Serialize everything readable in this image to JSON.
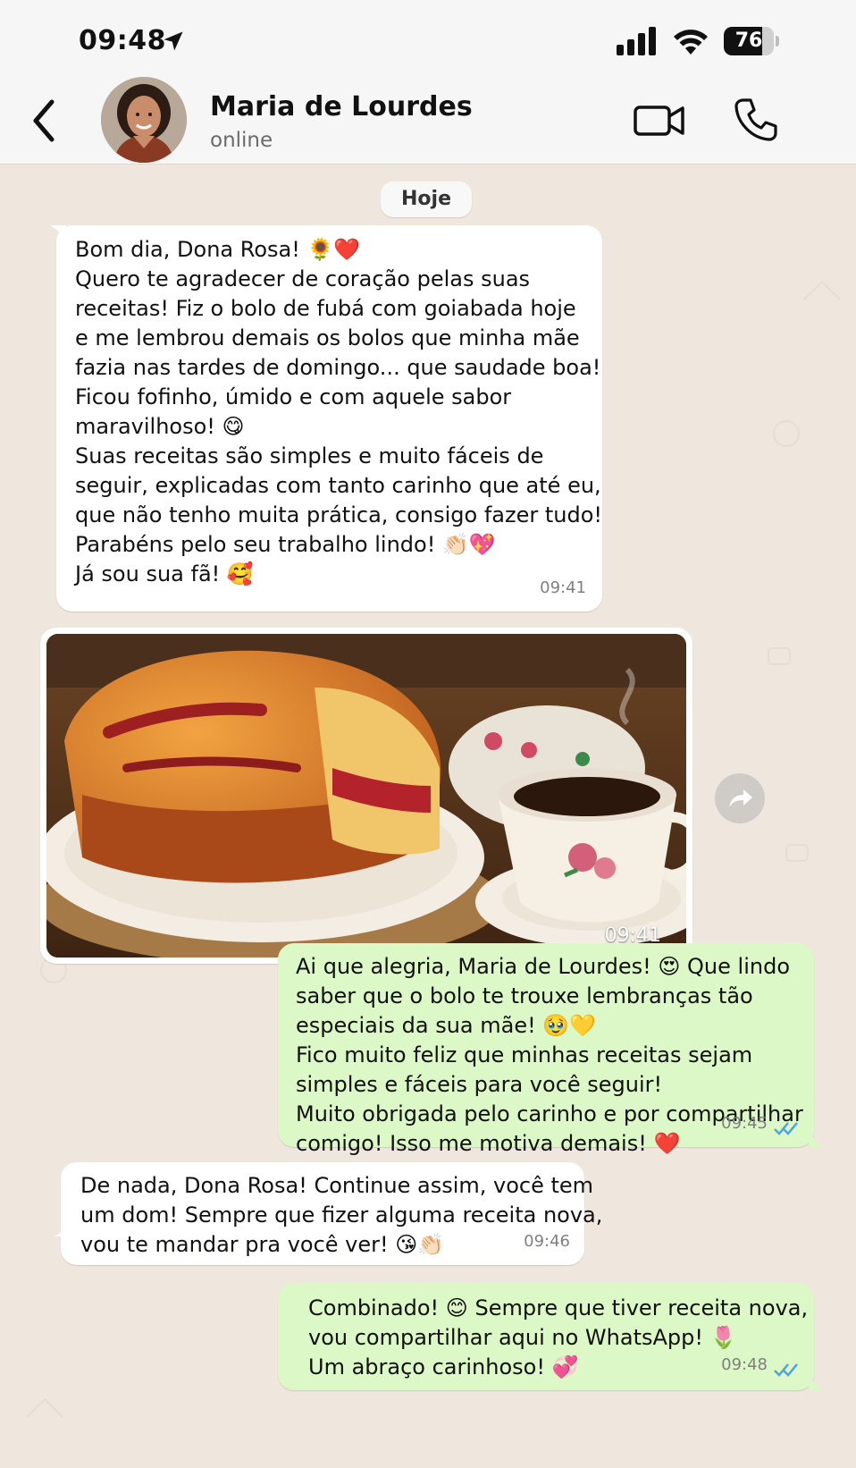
{
  "status_bar": {
    "time": "09:48",
    "battery_level": "76",
    "battery_fraction": 0.76,
    "icons": [
      "location-arrow-icon",
      "signal-icon",
      "wifi-icon",
      "battery-icon"
    ]
  },
  "header": {
    "contact_name": "Maria de Lourdes",
    "contact_status": "online",
    "icons": [
      "back-chevron-icon",
      "video-camera-icon",
      "phone-icon"
    ]
  },
  "chat": {
    "date_separator": "Hoje",
    "messages": [
      {
        "direction": "in",
        "lines": [
          "Bom dia, Dona Rosa! 🌻❤️",
          "Quero te agradecer de coração pelas suas",
          "receitas! Fiz o bolo de fubá com goiabada hoje",
          "e me lembrou demais os bolos que minha mãe",
          "fazia nas tardes de domingo... que saudade boa!",
          "Ficou fofinho, úmido e com aquele sabor",
          "maravilhoso! 😋",
          "Suas receitas são simples e muito fáceis de",
          "seguir, explicadas com tanto carinho que até eu,",
          "que não tenho muita prática, consigo fazer tudo!",
          "Parabéns pelo seu trabalho lindo! 👏🏻💖",
          "Já sou sua fã! 🥰"
        ],
        "time": "09:41"
      },
      {
        "direction": "in",
        "type": "image",
        "image_description_icon": "photo-cake-coffee",
        "time": "09:41"
      },
      {
        "direction": "out",
        "lines": [
          "Ai que alegria, Maria de Lourdes! 😍 Que lindo",
          "saber que o bolo te trouxe lembranças tão",
          "especiais da sua mãe! 🥹💛",
          "Fico muito feliz que minhas receitas sejam",
          "simples e fáceis para você seguir!",
          "Muito obrigada pelo carinho e por compartilhar",
          "comigo! Isso me motiva demais! ❤️"
        ],
        "time": "09:45",
        "read": true
      },
      {
        "direction": "in",
        "lines": [
          "De nada, Dona Rosa! Continue assim, você tem",
          "um dom! Sempre que fizer alguma receita nova,",
          "vou te mandar pra você ver! 😘👏🏻"
        ],
        "time": "09:46"
      },
      {
        "direction": "out",
        "lines": [
          "Combinado! 😊 Sempre que tiver receita nova,",
          "vou compartilhar aqui no WhatsApp! 🌷",
          "Um abraço carinhoso! 💞"
        ],
        "time": "09:48",
        "read": true
      }
    ]
  },
  "colors": {
    "chat_background": "#efe7dd",
    "incoming_bubble": "#ffffff",
    "outgoing_bubble": "#dcf8c6",
    "read_ticks": "#4fa3e3",
    "header_background": "#f6f6f6"
  }
}
